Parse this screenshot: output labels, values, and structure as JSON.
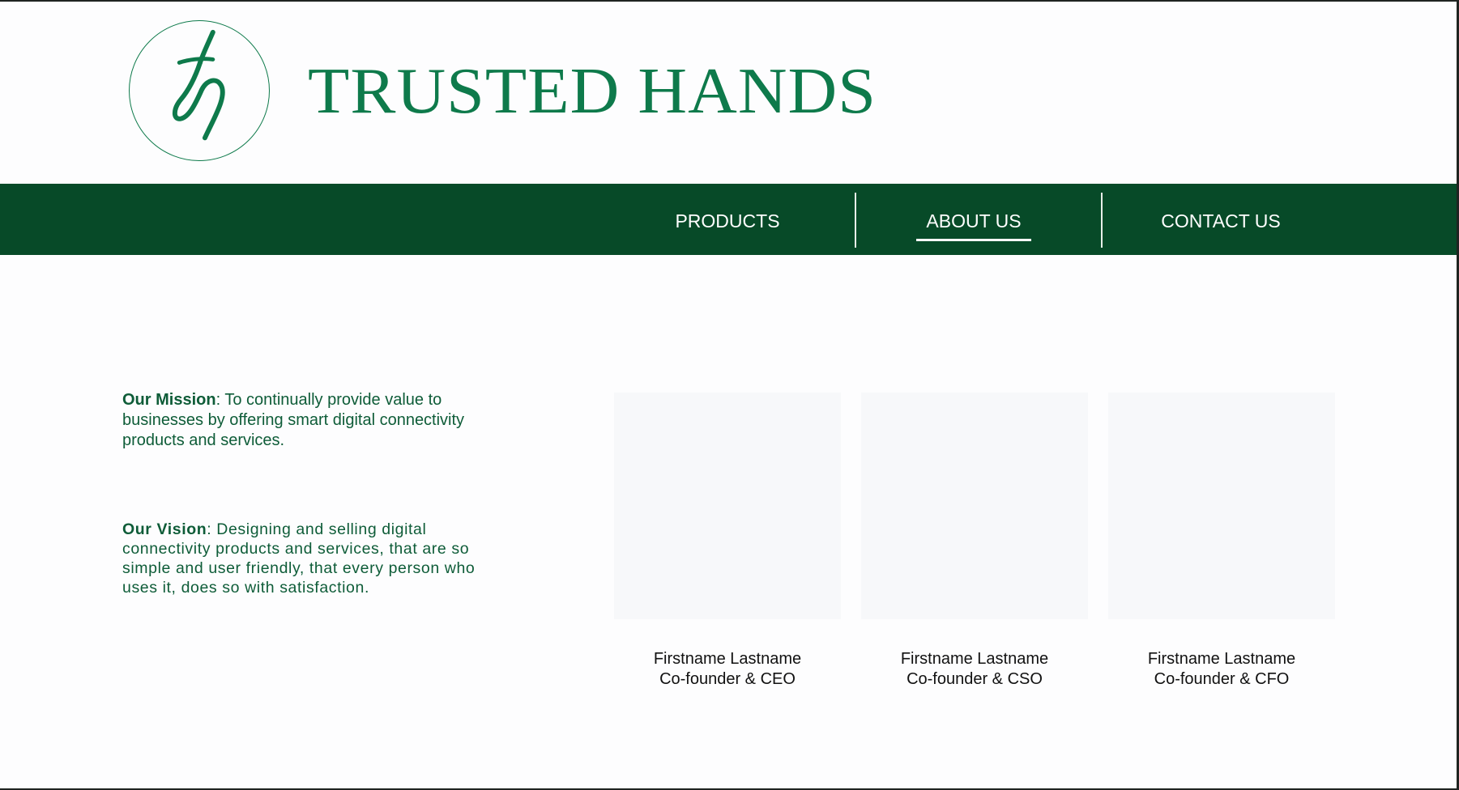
{
  "brand": {
    "name": "TRUSTED HANDS",
    "logo_icon": "th-monogram-logo",
    "color": "#0e7a4b"
  },
  "nav": {
    "background": "#074a28",
    "items": [
      {
        "label": "PRODUCTS",
        "active": false
      },
      {
        "label": "ABOUT US",
        "active": true
      },
      {
        "label": "CONTACT US",
        "active": false
      }
    ]
  },
  "about": {
    "mission": {
      "label": "Our Mission",
      "text": ": To continually provide value to businesses by offering smart digital connectivity products and services."
    },
    "vision": {
      "label": "Our Vision",
      "text": ": Designing and selling digital connectivity products and services, that are so simple and user friendly, that every person who uses it, does so with satisfaction."
    }
  },
  "team": [
    {
      "name": "Firstname Lastname",
      "role": "Co-founder & CEO"
    },
    {
      "name": "Firstname Lastname",
      "role": "Co-founder & CSO"
    },
    {
      "name": "Firstname Lastname",
      "role": "Co-founder & CFO"
    }
  ]
}
